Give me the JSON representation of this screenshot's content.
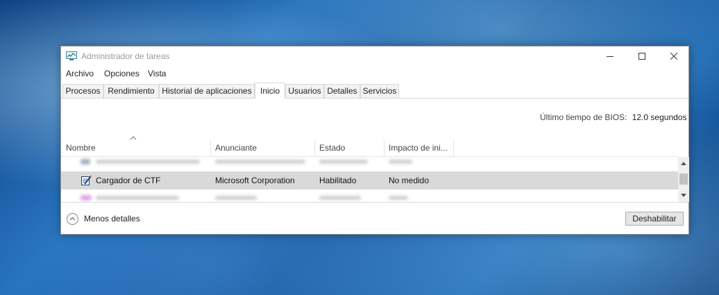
{
  "window": {
    "title": "Administrador de tareas"
  },
  "menu": [
    "Archivo",
    "Opciones",
    "Vista"
  ],
  "tabs": [
    {
      "label": "Procesos",
      "active": false
    },
    {
      "label": "Rendimiento",
      "active": false
    },
    {
      "label": "Historial de aplicaciones",
      "active": false
    },
    {
      "label": "Inicio",
      "active": true
    },
    {
      "label": "Usuarios",
      "active": false
    },
    {
      "label": "Detalles",
      "active": false
    },
    {
      "label": "Servicios",
      "active": false
    }
  ],
  "bios": {
    "label": "Último tiempo de BIOS:",
    "value": "12.0 segundos"
  },
  "columns": [
    "Nombre",
    "Anunciante",
    "Estado",
    "Impacto de ini..."
  ],
  "selected_row": {
    "name": "Cargador de CTF",
    "publisher": "Microsoft Corporation",
    "status": "Habilitado",
    "impact": "No medido"
  },
  "footer": {
    "less_details": "Menos detalles",
    "disable_button": "Deshabilitar"
  },
  "colors": {
    "selection": "#d9d9d9",
    "title_text": "#9b9b9b"
  }
}
